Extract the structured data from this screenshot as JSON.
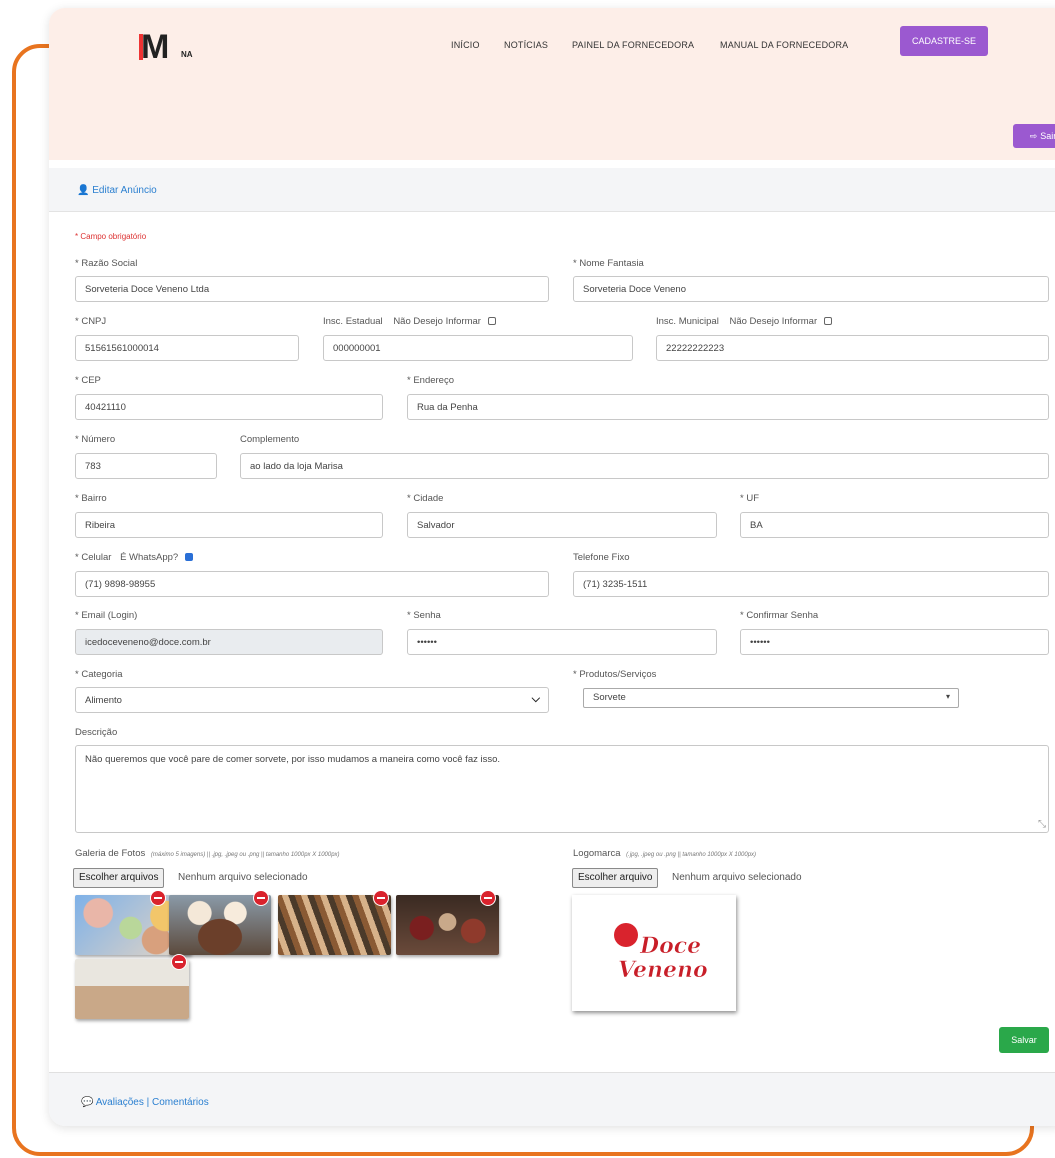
{
  "header": {
    "logo_text": "M",
    "nav": [
      "INÍCIO",
      "NOTÍCIAS",
      "PAINEL DA FORNECEDORA",
      "MANUAL DA FORNECEDORA"
    ],
    "signup_label": "CADASTRE-SE",
    "logout_label": "Sair",
    "logout_icon": "sign-out-icon"
  },
  "subheader": {
    "edit_link": "Editar Anúncio",
    "icon": "user-icon"
  },
  "form": {
    "required_note": "* Campo obrigatório",
    "razao_social": {
      "label": "* Razão Social",
      "value": "Sorveteria Doce Veneno Ltda"
    },
    "nome_fantasia": {
      "label": "* Nome Fantasia",
      "value": "Sorveteria Doce Veneno"
    },
    "cnpj": {
      "label": "* CNPJ",
      "value": "51561561000014"
    },
    "insc_estadual": {
      "label": "Insc. Estadual",
      "optout": "Não Desejo Informar",
      "value": "000000001"
    },
    "insc_municipal": {
      "label": "Insc. Municipal",
      "optout": "Não Desejo Informar",
      "value": "22222222223"
    },
    "cep": {
      "label": "* CEP",
      "value": "40421110"
    },
    "endereco": {
      "label": "* Endereço",
      "value": "Rua da Penha"
    },
    "numero": {
      "label": "* Número",
      "value": "783"
    },
    "complemento": {
      "label": "Complemento",
      "value": "ao lado da loja Marisa"
    },
    "bairro": {
      "label": "* Bairro",
      "value": "Ribeira"
    },
    "cidade": {
      "label": "* Cidade",
      "value": "Salvador"
    },
    "uf": {
      "label": "* UF",
      "value": "BA"
    },
    "celular": {
      "label": "* Celular",
      "whatsapp_label": "É WhatsApp?",
      "value": "(71) 9898-98955",
      "whatsapp_checked": true
    },
    "telefone": {
      "label": "Telefone Fixo",
      "value": "(71) 3235-1511"
    },
    "email": {
      "label": "* Email (Login)",
      "value": "icedoceveneno@doce.com.br"
    },
    "senha": {
      "label": "* Senha",
      "value": "••••••"
    },
    "confirmar_senha": {
      "label": "* Confirmar Senha",
      "value": "••••••"
    },
    "categoria": {
      "label": "* Categoria",
      "value": "Alimento"
    },
    "produtos": {
      "label": "* Produtos/Serviços",
      "value": "Sorvete"
    },
    "descricao": {
      "label": "Descrição",
      "value": "Não queremos que você pare de comer sorvete, por isso mudamos a maneira como você faz isso."
    },
    "galeria": {
      "label": "Galeria de Fotos",
      "hint": "(máximo 5 imagens) || .jpg, .jpeg ou .png || tamanho 1000px X 1000px)",
      "button": "Escolher arquivos",
      "status": "Nenhum arquivo selecionado"
    },
    "logomarca": {
      "label": "Logomarca",
      "hint": "(.jpg, .jpeg ou .png || tamanho 1000px X 1000px)",
      "button": "Escolher arquivo",
      "status": "Nenhum arquivo selecionado",
      "logo_line1": "Doce",
      "logo_line2": "Veneno"
    },
    "save_label": "Salvar"
  },
  "footer": {
    "link": "Avaliações | Comentários",
    "icon": "comments-icon"
  },
  "colors": {
    "orange": "#e8741f",
    "purple": "#9b59d0",
    "green": "#2aa84a",
    "link": "#2a7fd0",
    "header_bg": "#fdeee8"
  }
}
